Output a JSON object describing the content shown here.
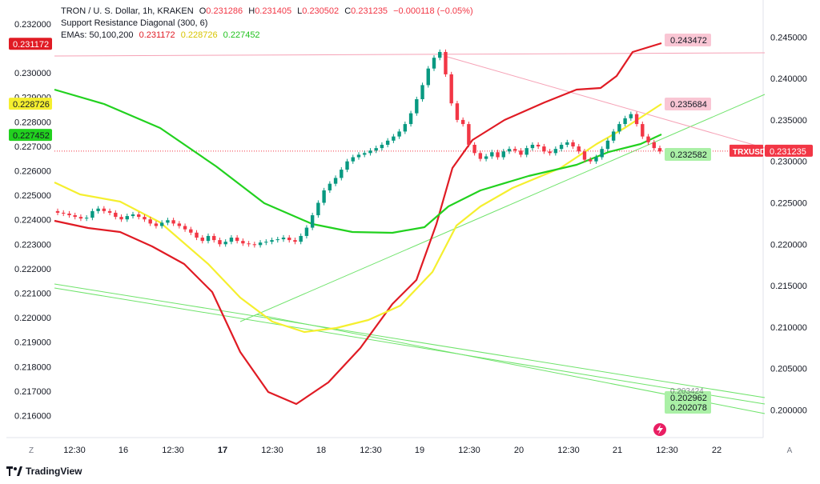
{
  "header": {
    "symbol": "TRON / U. S. Dollar, 1h, KRAKEN",
    "o_label": "O",
    "o_value": "0.231286",
    "h_label": "H",
    "h_value": "0.231405",
    "l_label": "L",
    "l_value": "0.230502",
    "c_label": "C",
    "c_value": "0.231235",
    "change": "−0.000118 (−0.05%)",
    "indicator": "Support Resistance Diagonal (300, 6)",
    "ema_label": "EMAs: 50,100,200",
    "ema1": "0.231172",
    "ema2": "0.228726",
    "ema3": "0.227452"
  },
  "colors": {
    "up": "#089981",
    "down": "#f23645",
    "ema50": "#e01b24",
    "ema100": "#f5ef2f",
    "ema200": "#22d11f",
    "diagonal_green": "#6fe36b",
    "diagonal_pink": "#f6a2b6"
  },
  "left_axis": {
    "ticks": [
      "0.232000",
      "0.230000",
      "0.229000",
      "0.228000",
      "0.227000",
      "0.226000",
      "0.225000",
      "0.224000",
      "0.223000",
      "0.222000",
      "0.221000",
      "0.220000",
      "0.219000",
      "0.218000",
      "0.217000",
      "0.216000"
    ],
    "badges": [
      {
        "text": "0.231172",
        "value": 0.231172,
        "bg": "#e01b24",
        "fg": "#ffffff"
      },
      {
        "text": "0.228726",
        "value": 0.228726,
        "bg": "#f5ef2f",
        "fg": "#131722"
      },
      {
        "text": "0.227452",
        "value": 0.227452,
        "bg": "#22d11f",
        "fg": "#131722"
      }
    ]
  },
  "right_axis": {
    "ticks": [
      "0.245000",
      "0.240000",
      "0.235000",
      "0.230000",
      "0.225000",
      "0.220000",
      "0.215000",
      "0.210000",
      "0.205000",
      "0.200000"
    ],
    "symbol_tag": "TRXUSD",
    "price_tag": "0.231235"
  },
  "x_axis": {
    "ticks": [
      "12:30",
      "16",
      "12:30",
      "17",
      "12:30",
      "18",
      "12:30",
      "19",
      "12:30",
      "20",
      "12:30",
      "21",
      "12:30",
      "22"
    ],
    "bold": [
      "17"
    ]
  },
  "corner_left": "Z",
  "corner_right": "A",
  "labels": [
    {
      "text": "0.243472",
      "value": 0.243472,
      "bg": "#f9c6d4",
      "fg": "#131722"
    },
    {
      "text": "0.235684",
      "value": 0.235684,
      "bg": "#f9c6d4",
      "fg": "#131722"
    },
    {
      "text": "0.232582",
      "value": 0.232582,
      "bg": "#aaf0a6",
      "fg": "#131722"
    },
    {
      "text": "0.202962",
      "value": 0.202962,
      "bg": "#aaf0a6",
      "fg": "#131722"
    },
    {
      "text": "0.202078",
      "value": 0.202078,
      "bg": "#aaf0a6",
      "fg": "#131722"
    }
  ],
  "hidden_label": "0.203424",
  "watermark": "TradingView",
  "chart_data": {
    "type": "candlestick",
    "title": "TRON / U. S. Dollar, 1h, KRAKEN",
    "ylim_right": [
      0.2,
      0.245
    ],
    "x_labels": [
      "12:30",
      "16",
      "12:30",
      "17",
      "12:30",
      "18",
      "12:30",
      "19",
      "12:30",
      "20",
      "12:30",
      "21",
      "12:30",
      "22"
    ],
    "candles_close": [
      0.2238,
      0.2237,
      0.2235,
      0.2233,
      0.2231,
      0.2232,
      0.224,
      0.2243,
      0.224,
      0.2238,
      0.2233,
      0.223,
      0.2234,
      0.2236,
      0.2233,
      0.223,
      0.2225,
      0.2222,
      0.2226,
      0.2229,
      0.2225,
      0.2222,
      0.2218,
      0.2214,
      0.2208,
      0.2204,
      0.221,
      0.2205,
      0.22,
      0.2203,
      0.2208,
      0.2204,
      0.2201,
      0.22,
      0.2199,
      0.2202,
      0.2203,
      0.2205,
      0.2206,
      0.2208,
      0.2205,
      0.2203,
      0.221,
      0.222,
      0.2235,
      0.225,
      0.2265,
      0.2273,
      0.228,
      0.229,
      0.23,
      0.2305,
      0.2308,
      0.231,
      0.2313,
      0.2316,
      0.232,
      0.2325,
      0.233,
      0.2336,
      0.2345,
      0.2358,
      0.2375,
      0.2392,
      0.2412,
      0.2425,
      0.2432,
      0.2405,
      0.237,
      0.235,
      0.2345,
      0.232,
      0.231,
      0.2303,
      0.2306,
      0.2311,
      0.2305,
      0.2312,
      0.2315,
      0.2313,
      0.2308,
      0.2316,
      0.232,
      0.2318,
      0.2312,
      0.231,
      0.2315,
      0.232,
      0.2323,
      0.2318,
      0.2312,
      0.2302,
      0.23,
      0.2305,
      0.2315,
      0.2325,
      0.2336,
      0.2345,
      0.2352,
      0.2357,
      0.2345,
      0.233,
      0.2323,
      0.2316,
      0.2312
    ],
    "ema50_right_end": 0.243472,
    "ema100_right_end": 0.235684,
    "ema200_right_end": 0.232582,
    "last_price": 0.231235
  }
}
